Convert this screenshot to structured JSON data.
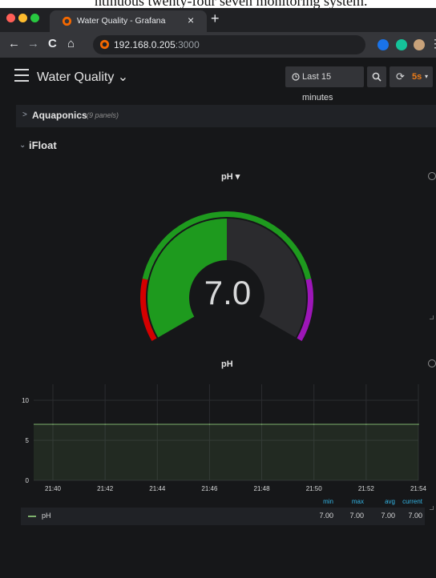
{
  "caption": {
    "text": "ntinuous twenty-four seven monitoring system."
  },
  "browser": {
    "tab_title": "Water Quality - Grafana",
    "tab_close": "×",
    "new_tab": "+",
    "url_host": "192.168.0.205",
    "url_port": ":3000",
    "back": "←",
    "forward": "→",
    "reload": "C",
    "home": "⌂",
    "menu": "⋮"
  },
  "grafana": {
    "dashboard_title": "Water Quality",
    "dashboard_caret": "⌄",
    "time_range": "Last 15 minutes",
    "refresh_interval": "5s",
    "rows": [
      {
        "name": "Aquaponics",
        "count": "(9 panels)",
        "chevron": ">"
      },
      {
        "name": "iFloat",
        "chevron": "⌄"
      }
    ],
    "gauge": {
      "title": "pH ▾",
      "value": "7.0",
      "min": 0,
      "max": 14,
      "thresholds": [
        {
          "to": 2.5,
          "color": "#d40000"
        },
        {
          "to": 11.5,
          "color": "#1e9a1e"
        },
        {
          "to": 14,
          "color": "#9d16b8"
        }
      ]
    },
    "graph_title": "pH"
  },
  "chart_data": {
    "type": "area",
    "title": "pH",
    "x": [
      "21:40",
      "21:42",
      "21:44",
      "21:46",
      "21:48",
      "21:50",
      "21:52",
      "21:54"
    ],
    "series": [
      {
        "name": "pH",
        "values": [
          7,
          7,
          7,
          7,
          7,
          7,
          7,
          7
        ],
        "color": "#7eb26d"
      }
    ],
    "yticks": [
      "0",
      "5",
      "10"
    ],
    "ylim": [
      0,
      12
    ],
    "grid": true,
    "legend": {
      "headers": [
        "min",
        "max",
        "avg",
        "current"
      ],
      "rows": [
        {
          "name": "pH",
          "min": "7.00",
          "max": "7.00",
          "avg": "7.00",
          "current": "7.00"
        }
      ]
    }
  }
}
